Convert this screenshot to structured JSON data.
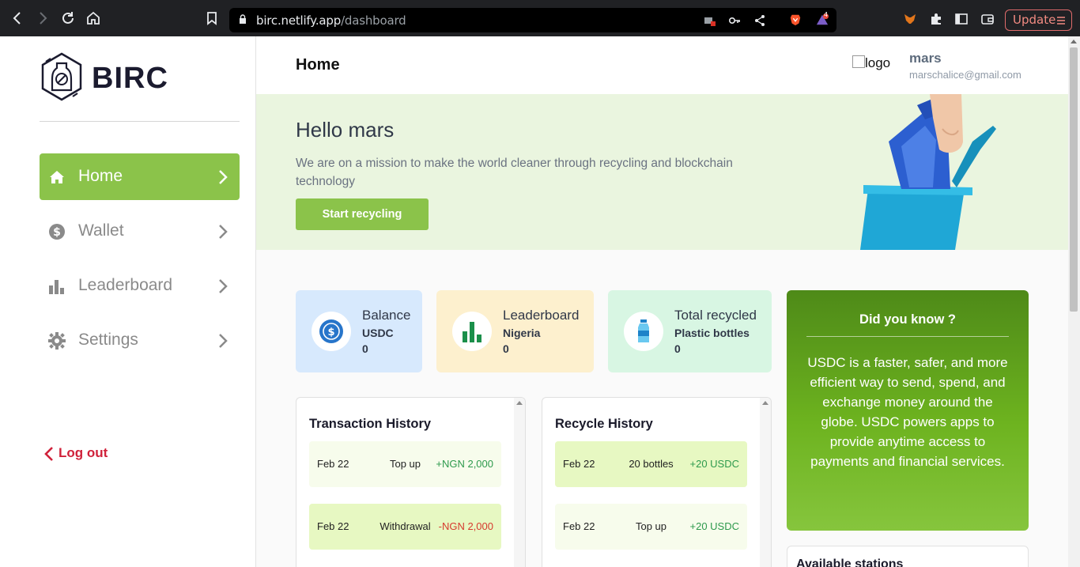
{
  "browser": {
    "url_host": "birc.netlify.app",
    "url_path": "/dashboard",
    "update_label": "Update",
    "extension_badge": "4"
  },
  "sidebar": {
    "brand": "BIRC",
    "items": [
      {
        "label": "Home",
        "icon": "home-icon",
        "active": true
      },
      {
        "label": "Wallet",
        "icon": "dollar-coin-icon",
        "active": false
      },
      {
        "label": "Leaderboard",
        "icon": "bar-chart-icon",
        "active": false
      },
      {
        "label": "Settings",
        "icon": "gear-icon",
        "active": false
      }
    ],
    "logout_label": "Log out"
  },
  "header": {
    "title": "Home",
    "logo_alt": "logo",
    "user_name": "mars",
    "user_email": "marschalice@gmail.com"
  },
  "hero": {
    "greeting": "Hello mars",
    "subtitle": "We are on a mission to make the world cleaner through recycling and blockchain technology",
    "cta_label": "Start recycling"
  },
  "stats": [
    {
      "title": "Balance",
      "subtitle": "USDC",
      "value": "0",
      "bg": "#d7e9fd",
      "icon": "usdc-icon"
    },
    {
      "title": "Leaderboard",
      "subtitle": "Nigeria",
      "value": "0",
      "bg": "#fdf0ce",
      "icon": "bar-chart-icon"
    },
    {
      "title": "Total recycled",
      "subtitle": "Plastic bottles",
      "value": "0",
      "bg": "#d8f6e3",
      "icon": "bottle-icon"
    }
  ],
  "did_you_know": {
    "title": "Did you know ?",
    "text": "USDC is a faster, safer, and more efficient way to send, spend, and exchange money around the globe. USDC powers apps to provide anytime access to payments and financial services."
  },
  "transaction_history": {
    "title": "Transaction History",
    "rows": [
      {
        "date": "Feb 22",
        "type": "Top up",
        "amount": "+NGN 2,000"
      },
      {
        "date": "Feb 22",
        "type": "Withdrawal",
        "amount": "-NGN 2,000"
      }
    ]
  },
  "recycle_history": {
    "title": "Recycle History",
    "rows": [
      {
        "date": "Feb 22",
        "type": "20 bottles",
        "amount": "+20 USDC"
      },
      {
        "date": "Feb 22",
        "type": "Top up",
        "amount": "+20 USDC"
      }
    ]
  },
  "stations": {
    "title": "Available stations"
  },
  "colors": {
    "accent": "#8bc34a",
    "logout": "#d0213a",
    "positive": "#2e9a4d",
    "negative": "#d63a2f"
  }
}
